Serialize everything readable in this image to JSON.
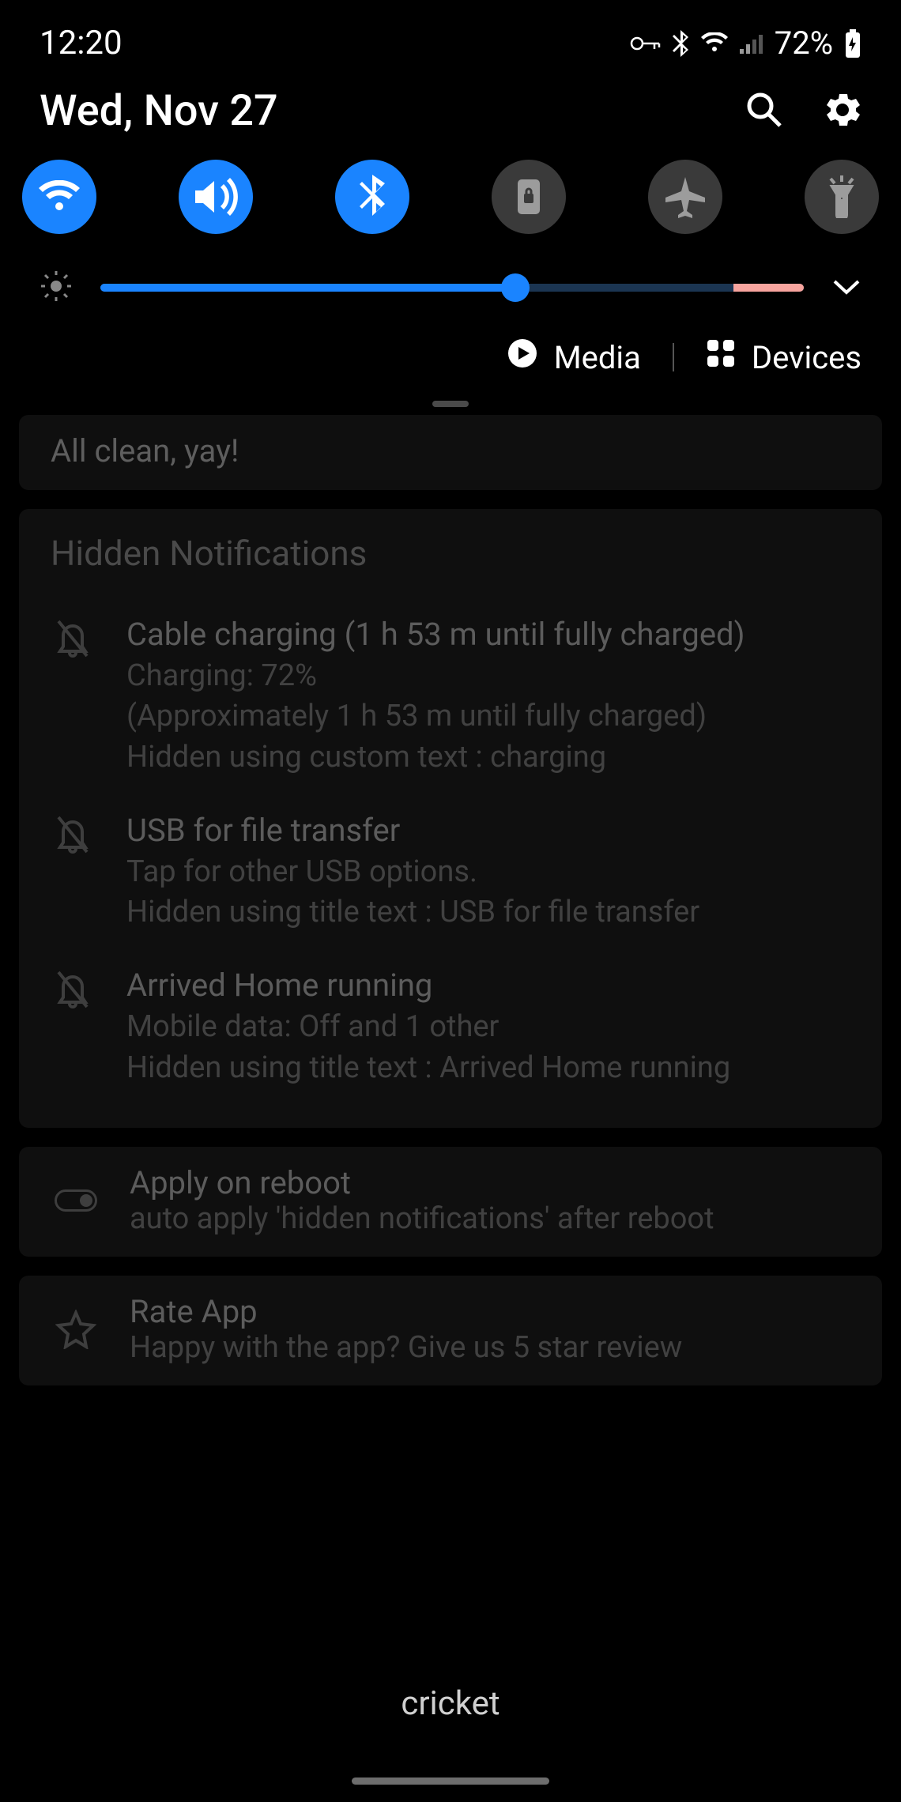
{
  "status": {
    "time": "12:20",
    "battery_pct": "72%"
  },
  "header": {
    "date": "Wed, Nov 27"
  },
  "toggles": {
    "wifi_active": true,
    "sound_active": true,
    "bluetooth_active": true,
    "rotation_active": false,
    "airplane_active": false,
    "flashlight_active": false
  },
  "brightness": {
    "pct": 59
  },
  "controls": {
    "media_label": "Media",
    "devices_label": "Devices"
  },
  "banner": {
    "text": "All clean, yay!"
  },
  "hidden_notifications": {
    "heading": "Hidden Notifications",
    "items": [
      {
        "title": "Cable charging (1 h 53 m until fully charged)",
        "line1": "Charging: 72%",
        "line2": "(Approximately 1 h 53 m until fully charged)",
        "line3": "Hidden using custom text : charging"
      },
      {
        "title": "USB for file transfer",
        "line1": "Tap for other USB options.",
        "line2": "Hidden using title text : USB for file transfer",
        "line3": ""
      },
      {
        "title": "Arrived Home running",
        "line1": "Mobile data: Off and 1 other",
        "line2": "Hidden using title text : Arrived Home running",
        "line3": ""
      }
    ]
  },
  "apply_reboot": {
    "title": "Apply on reboot",
    "subtitle": "auto apply 'hidden notifications' after reboot"
  },
  "rate": {
    "title": "Rate App",
    "subtitle": "Happy with the app? Give us 5 star review"
  },
  "carrier": "cricket"
}
